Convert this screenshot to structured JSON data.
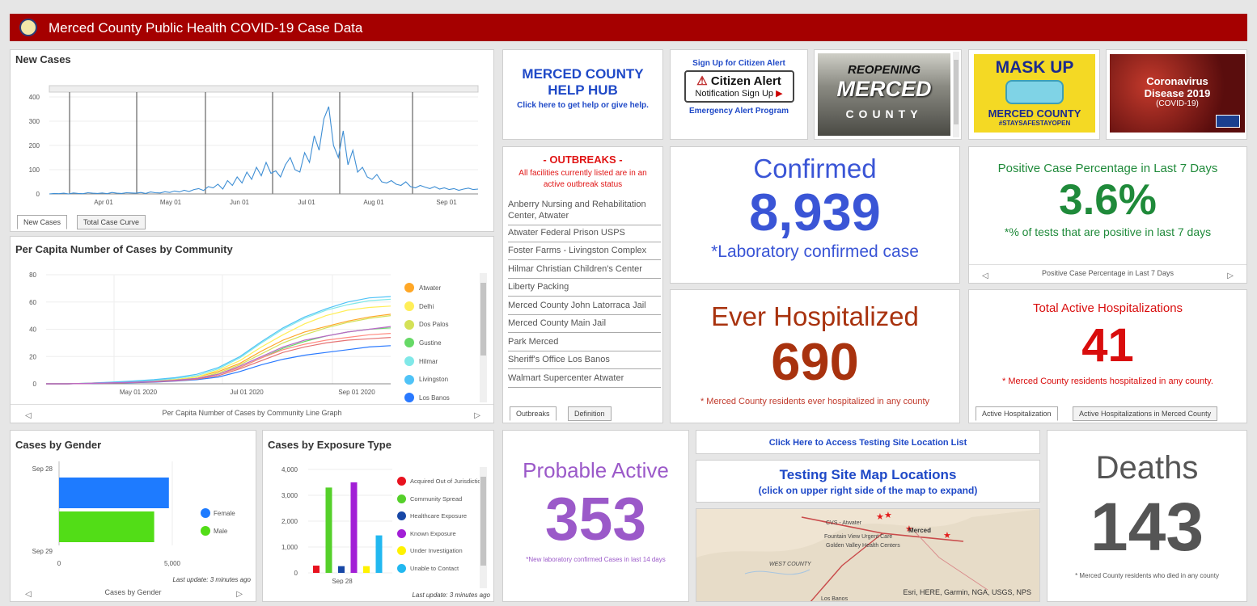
{
  "header": {
    "title": "Merced County Public Health COVID-19 Case Data",
    "bg": "#a50000"
  },
  "new_cases": {
    "title": "New Cases",
    "tabs": [
      "New Cases",
      "Total Case Curve"
    ],
    "chart_data": {
      "type": "line",
      "y_ticks": [
        "400",
        "300",
        "200",
        "100",
        "0"
      ],
      "x_ticks": [
        "Apr 01",
        "May 01",
        "Jun 01",
        "Jul 01",
        "Aug 01",
        "Sep 01"
      ],
      "ylim": [
        0,
        400
      ],
      "values": [
        0,
        2,
        1,
        3,
        0,
        4,
        2,
        1,
        5,
        3,
        2,
        4,
        1,
        6,
        3,
        2,
        5,
        4,
        3,
        6,
        2,
        8,
        5,
        4,
        9,
        6,
        12,
        8,
        15,
        10,
        18,
        22,
        14,
        30,
        25,
        40,
        20,
        55,
        35,
        70,
        45,
        90,
        60,
        110,
        75,
        130,
        85,
        95,
        70,
        120,
        150,
        100,
        90,
        170,
        130,
        240,
        180,
        310,
        360,
        200,
        150,
        260,
        120,
        180,
        90,
        110,
        70,
        60,
        80,
        50,
        45,
        55,
        40,
        35,
        50,
        30,
        25,
        35,
        28,
        22,
        30,
        20,
        25,
        18,
        22,
        15,
        20,
        24,
        18,
        20
      ]
    }
  },
  "per_capita": {
    "title": "Per Capita Number of Cases by Community",
    "footer": "Per Capita Number of Cases by Community Line Graph",
    "chart_data": {
      "type": "line",
      "y_ticks": [
        "80",
        "60",
        "40",
        "20",
        "0"
      ],
      "x_ticks": [
        "May 01 2020",
        "Jul 01 2020",
        "Sep 01 2020"
      ],
      "ylim": [
        0,
        80
      ],
      "series": [
        {
          "name": "Atwater",
          "color": "#ffa726",
          "values": [
            0,
            0,
            0.5,
            1,
            1.5,
            2,
            3,
            5,
            9,
            15,
            24,
            32,
            38,
            42,
            46,
            49,
            51
          ]
        },
        {
          "name": "Delhi",
          "color": "#ffee58",
          "values": [
            0,
            0,
            0.4,
            1,
            1.5,
            2,
            3,
            5,
            10,
            17,
            27,
            36,
            44,
            50,
            54,
            56,
            57
          ]
        },
        {
          "name": "Dos Palos",
          "color": "#d4e157",
          "values": [
            0,
            0,
            0.3,
            0.8,
            1.2,
            2,
            3,
            4,
            8,
            14,
            22,
            30,
            36,
            41,
            45,
            48,
            50
          ]
        },
        {
          "name": "Gustine",
          "color": "#66d966",
          "values": [
            0,
            0,
            0.3,
            0.7,
            1,
            1.6,
            2.5,
            4,
            7,
            12,
            19,
            26,
            31,
            35,
            38,
            40,
            41
          ]
        },
        {
          "name": "Hilmar",
          "color": "#80e8e8",
          "values": [
            0,
            0,
            0.5,
            1,
            1.8,
            2.5,
            4,
            6,
            11,
            19,
            30,
            40,
            48,
            54,
            58,
            61,
            62
          ]
        },
        {
          "name": "Livingston",
          "color": "#4fc3f7",
          "values": [
            0,
            0,
            0.5,
            1.2,
            2,
            3,
            4.5,
            7,
            12,
            20,
            31,
            41,
            49,
            55,
            60,
            63,
            64
          ]
        },
        {
          "name": "Los Banos",
          "color": "#2979ff",
          "values": [
            0,
            0,
            0.2,
            0.5,
            0.8,
            1.2,
            2,
            3,
            5,
            9,
            14,
            18,
            21,
            23,
            25,
            27,
            28
          ]
        },
        {
          "name": "",
          "color": "#ff8a80",
          "values": [
            0,
            0,
            0.3,
            0.6,
            1,
            1.5,
            2.5,
            4,
            7,
            12,
            19,
            25,
            29,
            32,
            34,
            36,
            37
          ]
        },
        {
          "name": "",
          "color": "#e57373",
          "values": [
            0,
            0,
            0.3,
            0.6,
            1,
            1.4,
            2.2,
            3.5,
            6,
            11,
            17,
            23,
            27,
            30,
            32,
            33,
            34
          ]
        },
        {
          "name": "",
          "color": "#ba68c8",
          "values": [
            0,
            0,
            0.3,
            0.7,
            1.1,
            1.7,
            2.6,
            4,
            7,
            13,
            20,
            27,
            32,
            35,
            38,
            40,
            42
          ]
        }
      ]
    }
  },
  "gender": {
    "title": "Cases by Gender",
    "footer": "Cases by Gender",
    "update": "Last update: 3 minutes ago",
    "chart_data": {
      "type": "bar",
      "y_ticks": [
        "Sep 28",
        "Sep 29"
      ],
      "x_ticks": [
        "0",
        "5,000"
      ],
      "xlim": [
        0,
        5000
      ],
      "series": [
        {
          "name": "Female",
          "color": "#1e7bff",
          "values": [
            4850
          ]
        },
        {
          "name": "Male",
          "color": "#52dd17",
          "values": [
            4200
          ]
        }
      ]
    }
  },
  "exposure": {
    "title": "Cases by Exposure Type",
    "update": "Last update: 3 minutes ago",
    "chart_data": {
      "type": "bar",
      "categories": [
        "Sep 28"
      ],
      "y_ticks": [
        "4,000",
        "3,000",
        "2,000",
        "1,000",
        "0"
      ],
      "ylim": [
        0,
        4000
      ],
      "series": [
        {
          "name": "Acquired Out of Jurisdiction",
          "color": "#e8121f",
          "values": [
            280
          ]
        },
        {
          "name": "Community Spread",
          "color": "#55d02a",
          "values": [
            3300
          ]
        },
        {
          "name": "Healthcare Exposure",
          "color": "#1747a6",
          "values": [
            260
          ]
        },
        {
          "name": "Known Exposure",
          "color": "#a21fd6",
          "values": [
            3500
          ]
        },
        {
          "name": "Under Investigation",
          "color": "#fff200",
          "values": [
            260
          ]
        },
        {
          "name": "Unable to Contact",
          "color": "#22b8f0",
          "values": [
            1450
          ]
        }
      ]
    }
  },
  "help_hub": {
    "title_line1": "MERCED COUNTY",
    "title_line2": "HELP HUB",
    "sub": "Click here to get help or give help."
  },
  "citizen_alert": {
    "top": "Sign Up for Citizen Alert",
    "brand": "Citizen Alert",
    "sub": "Notification Sign Up",
    "bottom": "Emergency Alert Program"
  },
  "reopening": {
    "line1": "REOPENING",
    "line2": "MERCED",
    "line3": "COUNTY"
  },
  "mask_up": {
    "line1": "MASK UP",
    "line2": "MERCED COUNTY",
    "line3": "#STAYSAFESTAYOPEN"
  },
  "coronavirus": {
    "line1": "Coronavirus",
    "line2": "Disease 2019",
    "line3": "(COVID-19)"
  },
  "outbreaks": {
    "title": "- OUTBREAKS -",
    "note": "All facilities currently listed are in an active outbreak status",
    "items": [
      "Anberry Nursing and Rehabilitation Center, Atwater",
      "Atwater Federal Prison USPS",
      "Foster Farms - Livingston Complex",
      "Hilmar Christian Children's Center",
      "Liberty Packing",
      "Merced County John Latorraca Jail",
      "Merced County Main Jail",
      "Park Merced",
      "Sheriff's Office Los Banos",
      "Walmart Supercenter Atwater"
    ],
    "tabs": [
      "Outbreaks",
      "Definition"
    ]
  },
  "confirmed": {
    "label": "Confirmed",
    "value": "8,939",
    "note": "*Laboratory confirmed case",
    "color": "#3a55d6"
  },
  "positive_pct": {
    "label": "Positive Case Percentage in Last 7 Days",
    "value": "3.6%",
    "note": "*% of tests that are positive in last 7 days",
    "footer": "Positive Case Percentage in Last 7 Days",
    "color": "#1f8a3a"
  },
  "ever_hosp": {
    "label": "Ever Hospitalized",
    "value": "690",
    "note": "* Merced County residents ever hospitalized in any county",
    "color": "#a8320e"
  },
  "active_hosp": {
    "label": "Total Active Hospitalizations",
    "value": "41",
    "note": "* Merced County residents hospitalized in any county.",
    "tabs": [
      "Active Hospitalization",
      "Active Hospitalizations in Merced County"
    ],
    "color": "#d90d0d"
  },
  "probable": {
    "label": "Probable Active",
    "value": "353",
    "note": "*New laboratory confirmed Cases in last 14 days",
    "color": "#9b59c9"
  },
  "testing": {
    "link": "Click Here to Access Testing Site Location List",
    "map_title": "Testing Site Map Locations",
    "map_sub": "(click on upper right side of the map to expand)",
    "map_labels": [
      "CVS - Atwater",
      "Merced",
      "Fountain View Urgent Care",
      "Golden Valley Health Centers",
      "WEST COUNTY",
      "Los Banos"
    ],
    "attribution": "Esri, HERE, Garmin, NGA, USGS, NPS"
  },
  "deaths": {
    "label": "Deaths",
    "value": "143",
    "note": "* Merced County residents who died in any county",
    "color": "#555555"
  }
}
